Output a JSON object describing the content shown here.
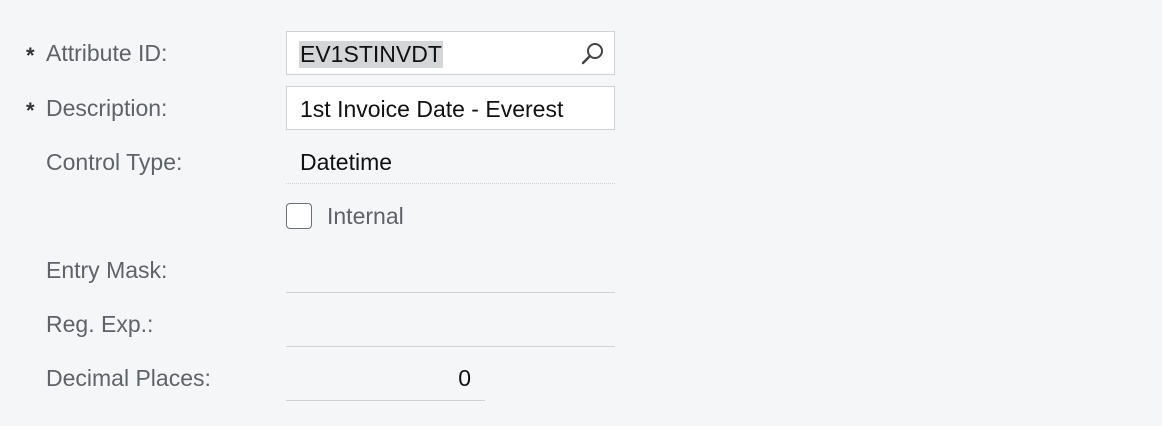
{
  "fields": {
    "attribute_id": {
      "required": "*",
      "label": "Attribute ID:",
      "value": "EV1STINVDT",
      "icon": "search-icon"
    },
    "description": {
      "required": "*",
      "label": "Description:",
      "value": "1st Invoice Date - Everest"
    },
    "control_type": {
      "label": "Control Type:",
      "value": "Datetime"
    },
    "internal": {
      "label": "Internal",
      "checked": false
    },
    "entry_mask": {
      "label": "Entry Mask:",
      "value": ""
    },
    "reg_exp": {
      "label": "Reg. Exp.:",
      "value": ""
    },
    "decimal_places": {
      "label": "Decimal Places:",
      "value": "0"
    }
  }
}
